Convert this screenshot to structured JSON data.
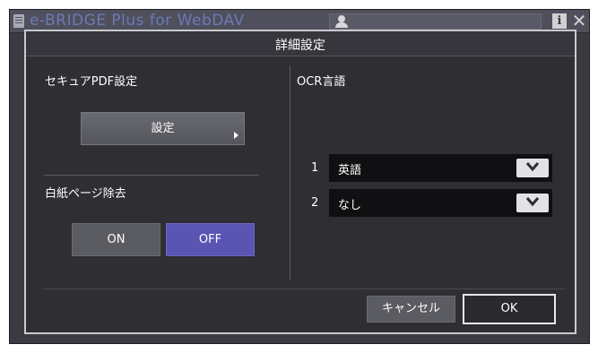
{
  "app": {
    "title": "e-BRIDGE Plus for WebDAV",
    "user_name": ""
  },
  "dialog": {
    "title": "詳細設定",
    "secure_pdf": {
      "label": "セキュアPDF設定",
      "settings_button": "設定"
    },
    "blank_page_removal": {
      "label": "白紙ページ除去",
      "on_label": "ON",
      "off_label": "OFF",
      "selected": "OFF"
    },
    "ocr": {
      "label": "OCR言語",
      "languages": [
        {
          "number": "1",
          "value": "英語"
        },
        {
          "number": "2",
          "value": "なし"
        }
      ]
    },
    "buttons": {
      "cancel": "キャンセル",
      "ok": "OK"
    }
  },
  "colors": {
    "dialog_bg": "#2e2e33",
    "accent_selected": "#5a55b3",
    "title_link": "#6b79b8"
  },
  "icons": {
    "app": "document-icon",
    "user": "user-icon",
    "info": "info-icon",
    "close": "close-icon",
    "dropdown": "chevron-down-icon",
    "button_arrow": "triangle-right-icon"
  }
}
